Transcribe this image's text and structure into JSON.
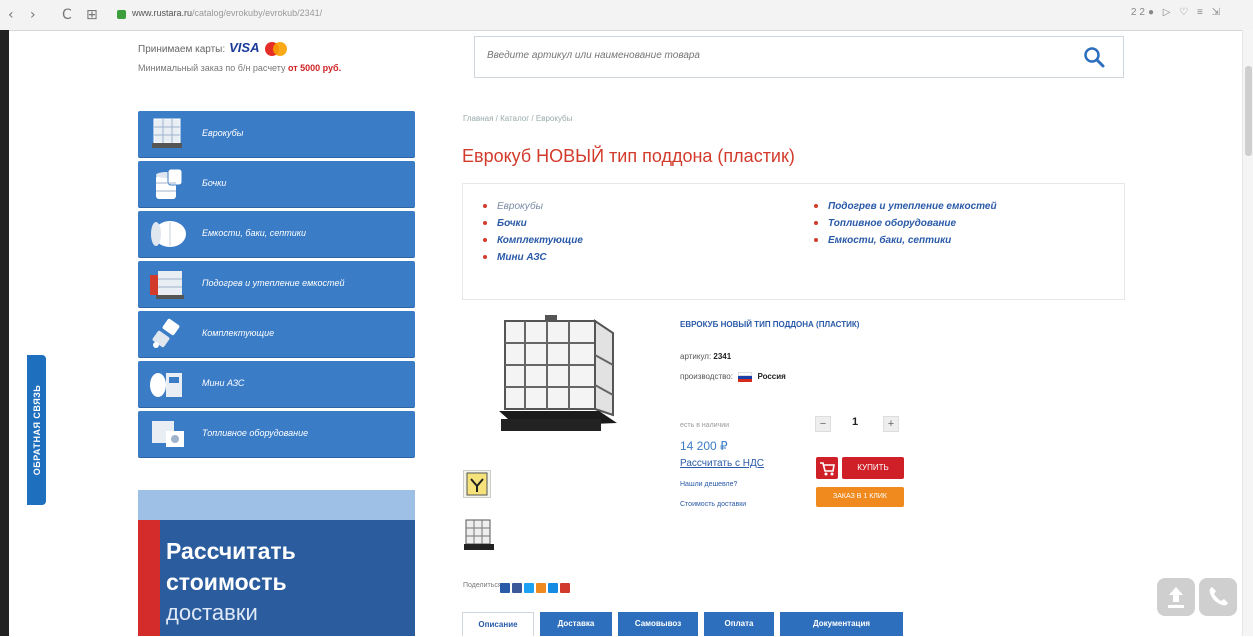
{
  "browser": {
    "back": "‹",
    "forward": "›",
    "reload": "C",
    "grid": "⊞",
    "url_host": "www.rustara.ru",
    "url_rest": "/catalog/evrokuby/evrokub/2341/",
    "right_icons": "22● ▷ ♡ ≡ ⇲"
  },
  "feedback": {
    "label": "ОБРАТНАЯ СВЯЗЬ"
  },
  "header": {
    "payment_label": "Принимаем карты:",
    "visa": "VISA",
    "min_order_text": "Минимальный заказ по б/н расчету ",
    "min_order_amount": "от 5000 руб."
  },
  "search": {
    "placeholder": "Введите артикул или наименование товара"
  },
  "menu": {
    "items": [
      {
        "label": "Еврокубы",
        "icon": "eurocube-icon"
      },
      {
        "label": "Бочки",
        "icon": "barrel-icon"
      },
      {
        "label": "Емкости, баки, септики",
        "icon": "tank-icon"
      },
      {
        "label": "Подогрев и утепление емкостей",
        "icon": "heating-icon"
      },
      {
        "label": "Комплектующие",
        "icon": "parts-icon"
      },
      {
        "label": "Мини АЗС",
        "icon": "mini-station-icon"
      },
      {
        "label": "Топливное оборудование",
        "icon": "fuel-equipment-icon"
      }
    ]
  },
  "banner": {
    "line1": "Рассчитать",
    "line2": "стоимость",
    "line3": "доставки"
  },
  "breadcrumb": "Главная  /  Каталог  /  Еврокубы",
  "page_title": "Еврокуб НОВЫЙ тип поддона (пластик)",
  "categories": {
    "left": [
      "Еврокубы",
      "Бочки",
      "Комплектующие",
      "Мини АЗС"
    ],
    "right": [
      "Подогрев и утепление емкостей",
      "Топливное оборудование",
      "Емкости, баки, септики"
    ]
  },
  "product": {
    "name": "ЕВРОКУБ НОВЫЙ ТИП ПОДДОНА (ПЛАСТИК)",
    "article_label": "артикул:",
    "article_value": "2341",
    "producer_label": "производство:",
    "producer_value": "Россия",
    "stock": "есть в наличии",
    "price": "14 200 ₽",
    "vat_link": "Рассчитать с НДС",
    "cheaper": "Нашли дешевле?",
    "delivery_cost": "Стоимость доставки",
    "quantity": "1",
    "minus": "−",
    "plus": "+",
    "buy_label": "купить",
    "one_click_label": "ЗАКАЗ В 1 КЛИК"
  },
  "share": {
    "label": "Поделиться:"
  },
  "tabs": [
    "Описание",
    "Доставка",
    "Самовывоз",
    "Оплата",
    "Документация"
  ],
  "colors": {
    "menu_blue": "#3b7cc6",
    "title_red": "#d23b2c",
    "buy_red": "#cf2027",
    "one_click_orange": "#f08a1e",
    "tab_blue": "#2d6fbd"
  }
}
